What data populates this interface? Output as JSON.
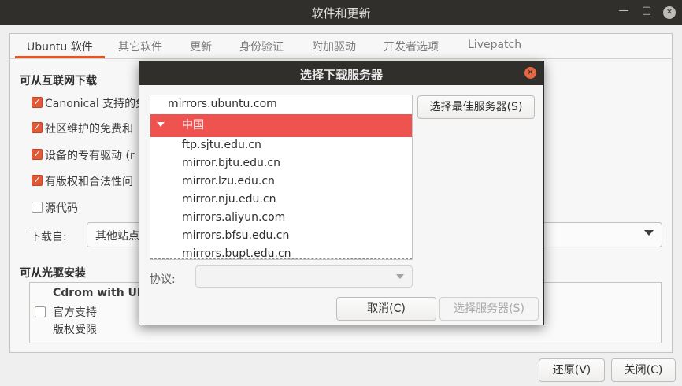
{
  "window": {
    "title": "软件和更新",
    "controls": {
      "minimize": "—",
      "maximize": "□",
      "close": "✕"
    }
  },
  "tabs": [
    "Ubuntu 软件",
    "其它软件",
    "更新",
    "身份验证",
    "附加驱动",
    "开发者选项",
    "Livepatch"
  ],
  "active_tab": "Ubuntu 软件",
  "internet": {
    "heading": "可从互联网下载",
    "options": [
      {
        "label": "Canonical 支持的免",
        "checked": true
      },
      {
        "label": "社区维护的免费和",
        "checked": true
      },
      {
        "label": "设备的专有驱动 (r",
        "checked": true
      },
      {
        "label": "有版权和合法性问",
        "checked": true
      },
      {
        "label": "源代码",
        "checked": false
      }
    ],
    "download_from_label": "下载自:",
    "download_from_value": "其他站点"
  },
  "cdrom": {
    "heading": "可从光驱安装",
    "title": "Cdrom with Ubu",
    "line1": "官方支持",
    "line2": "版权受限",
    "checked": false
  },
  "footer": {
    "revert_label": "还原(V)",
    "close_label": "关闭(C)"
  },
  "dialog": {
    "title": "选择下载服务器",
    "close_icon": "✕",
    "best_server_label": "选择最佳服务器(S)",
    "servers": {
      "main": "mirrors.ubuntu.com",
      "country": "中国",
      "mirrors": [
        "ftp.sjtu.edu.cn",
        "mirror.bjtu.edu.cn",
        "mirror.lzu.edu.cn",
        "mirror.nju.edu.cn",
        "mirrors.aliyun.com",
        "mirrors.bfsu.edu.cn",
        "mirrors.bupt.edu.cn"
      ]
    },
    "protocol_label": "协议:",
    "protocol_value": "",
    "cancel_label": "取消(C)",
    "choose_label": "选择服务器(S)"
  },
  "colors": {
    "accent": "#e95420",
    "selection": "#ef5350",
    "titlebar": "#302f2c"
  }
}
